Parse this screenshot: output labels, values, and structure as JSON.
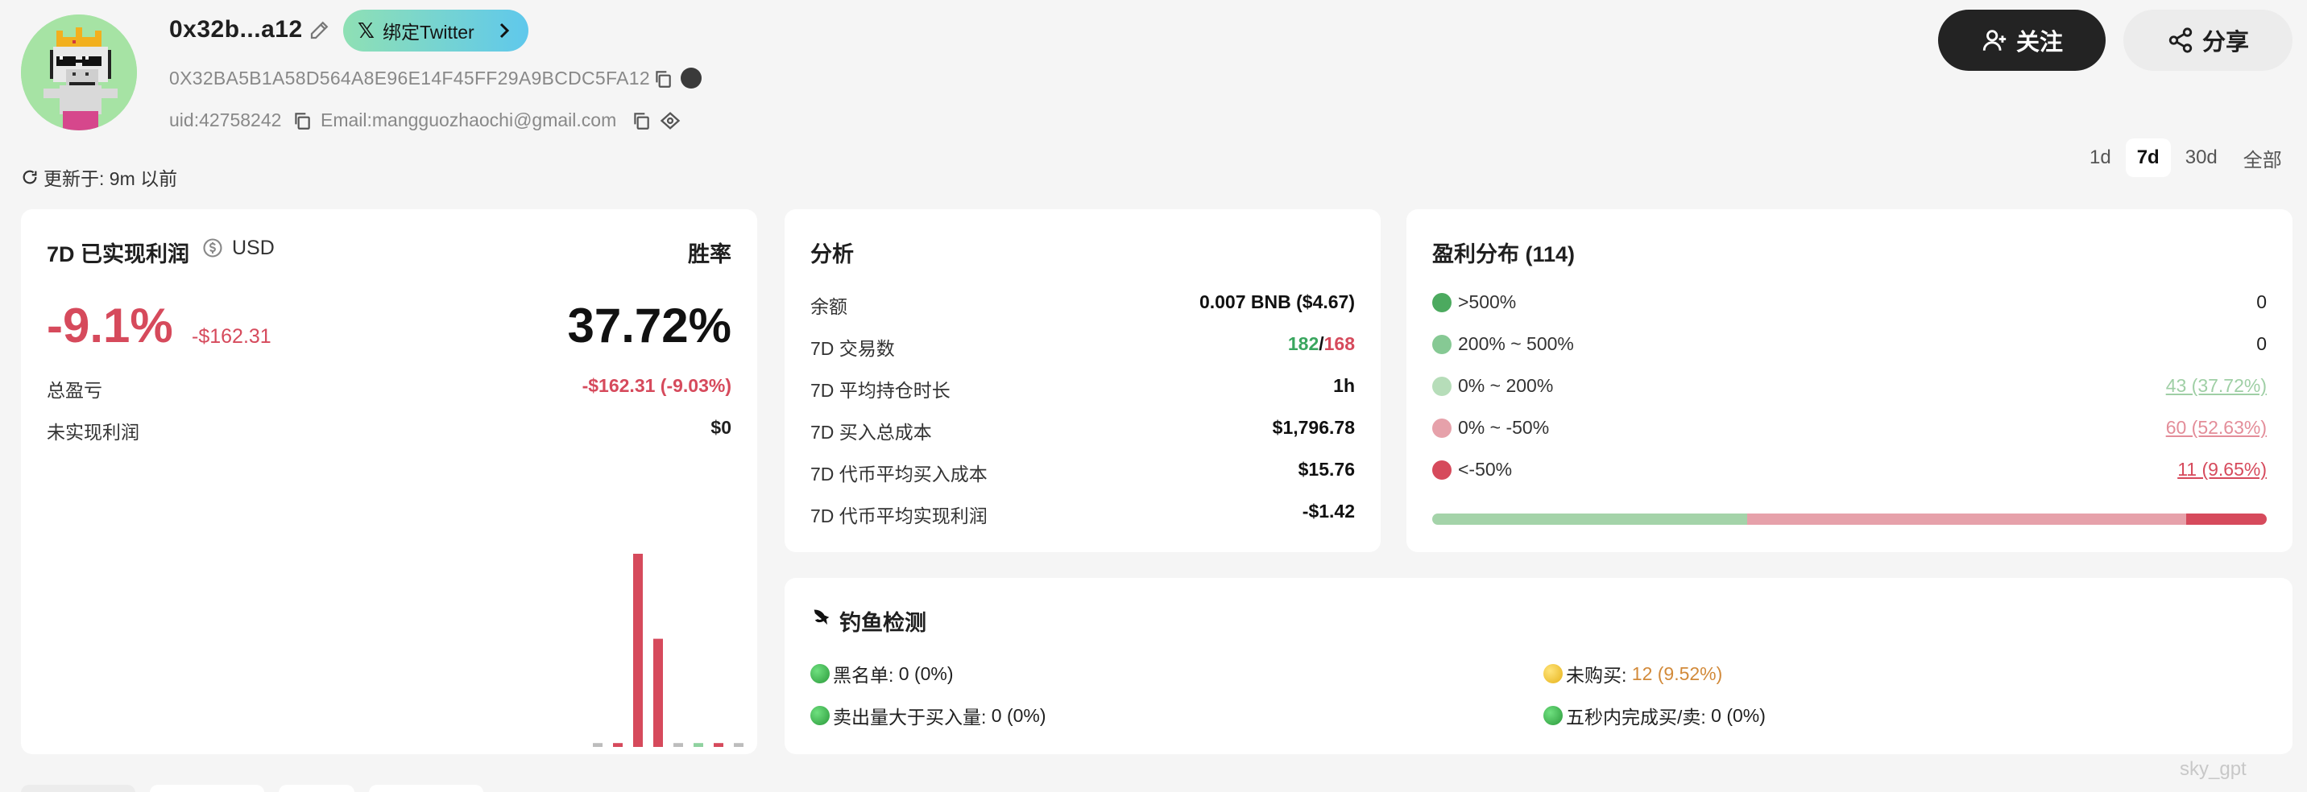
{
  "header": {
    "address_short": "0x32b...a12",
    "twitter_button": "绑定Twitter",
    "twitter_x": "𝕏",
    "full_address": "0X32BA5B1A58D564A8E96E14F45FF29A9BCDC5FA12",
    "uid": "uid:42758242",
    "email": "Email:mangguozhaochi@gmail.com",
    "follow_label": "关注",
    "share_label": "分享",
    "updated": "更新于: 9m 以前"
  },
  "periods": [
    {
      "label": "1d",
      "active": false
    },
    {
      "label": "7d",
      "active": true
    },
    {
      "label": "30d",
      "active": false
    },
    {
      "label": "全部",
      "active": false
    }
  ],
  "pnl_card": {
    "title": "7D 已实现利润",
    "currency": "USD",
    "winrate_label": "胜率",
    "pnl_percent": "-9.1%",
    "pnl_usd": "-$162.31",
    "winrate": "37.72%",
    "total_pnl_label": "总盈亏",
    "total_pnl_value": "-$162.31 (-9.03%)",
    "unrealized_label": "未实现利润",
    "unrealized_value": "$0"
  },
  "chart_data": {
    "type": "bar",
    "categories": [
      "",
      "",
      "",
      "",
      "",
      "",
      "",
      ""
    ],
    "values": [
      0.02,
      -0.02,
      1.0,
      0.56,
      -0.02,
      0.02,
      -0.02,
      0.02
    ],
    "colors": [
      "#bdbdbd",
      "#d64a5c",
      "#d64a5c",
      "#d64a5c",
      "#bdbdbd",
      "#8fd2a0",
      "#d64a5c",
      "#bdbdbd"
    ],
    "title": "",
    "xlabel": "",
    "ylabel": "",
    "grid": false
  },
  "analysis": {
    "title": "分析",
    "rows": [
      {
        "label": "余额",
        "value": "0.007 BNB ($4.67)"
      },
      {
        "label": "7D 交易数",
        "value_buy": "182",
        "value_sep": "/",
        "value_sell": "168"
      },
      {
        "label": "7D 平均持仓时长",
        "value": "1h"
      },
      {
        "label": "7D 买入总成本",
        "value": "$1,796.78"
      },
      {
        "label": "7D 代币平均买入成本",
        "value": "$15.76"
      },
      {
        "label": "7D 代币平均实现利润",
        "value": "-$1.42"
      }
    ]
  },
  "distribution": {
    "title": "盈利分布 (114)",
    "rows": [
      {
        "label": ">500%",
        "value": "0",
        "color": "#4caa5f"
      },
      {
        "label": "200% ~ 500%",
        "value": "0",
        "color": "#86c994"
      },
      {
        "label": "0% ~ 200%",
        "value": "43 (37.72%)",
        "color": "#b6ddb9"
      },
      {
        "label": "0% ~ -50%",
        "value": "60 (52.63%)",
        "color": "#e6a1aa"
      },
      {
        "label": "<-50%",
        "value": "11 (9.65%)",
        "color": "#d64a5c"
      }
    ],
    "bar_shares": [
      0.3772,
      0.5263,
      0.0965
    ]
  },
  "phishing": {
    "title": "钓鱼检测",
    "blacklist_label": "黑名单:",
    "blacklist_value": "0 (0%)",
    "not_bought_label": "未购买:",
    "not_bought_value": "12 (9.52%)",
    "sell_gt_buy_label": "卖出量大于买入量:",
    "sell_gt_buy_value": "0 (0%)",
    "fast_trade_label": "五秒内完成买/卖:",
    "fast_trade_value": "0 (0%)"
  },
  "watermark": "sky_gpt"
}
